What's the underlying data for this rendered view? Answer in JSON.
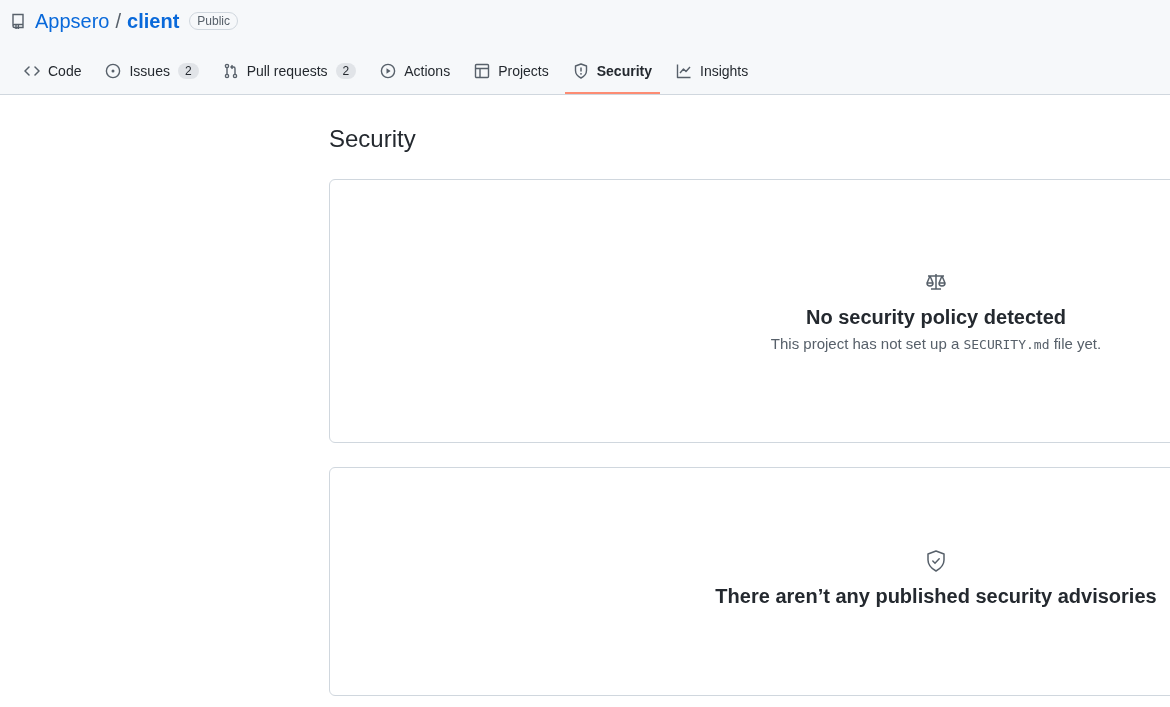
{
  "repo": {
    "owner": "Appsero",
    "separator": "/",
    "name": "client",
    "visibility": "Public"
  },
  "tabs": [
    {
      "kind": "code",
      "label": "Code",
      "selected": false
    },
    {
      "kind": "issues",
      "label": "Issues",
      "count": "2",
      "selected": false
    },
    {
      "kind": "pulls",
      "label": "Pull requests",
      "count": "2",
      "selected": false
    },
    {
      "kind": "actions",
      "label": "Actions",
      "selected": false
    },
    {
      "kind": "projects",
      "label": "Projects",
      "selected": false
    },
    {
      "kind": "security",
      "label": "Security",
      "selected": true
    },
    {
      "kind": "insights",
      "label": "Insights",
      "selected": false
    }
  ],
  "page_title": "Security",
  "cards": [
    {
      "kind": "policy",
      "title": "No security policy detected",
      "description": {
        "before": "This project has not set up a ",
        "code": "SECURITY.md",
        "after": " file yet."
      }
    },
    {
      "kind": "advisories",
      "title": "There aren’t any published security advisories"
    }
  ]
}
